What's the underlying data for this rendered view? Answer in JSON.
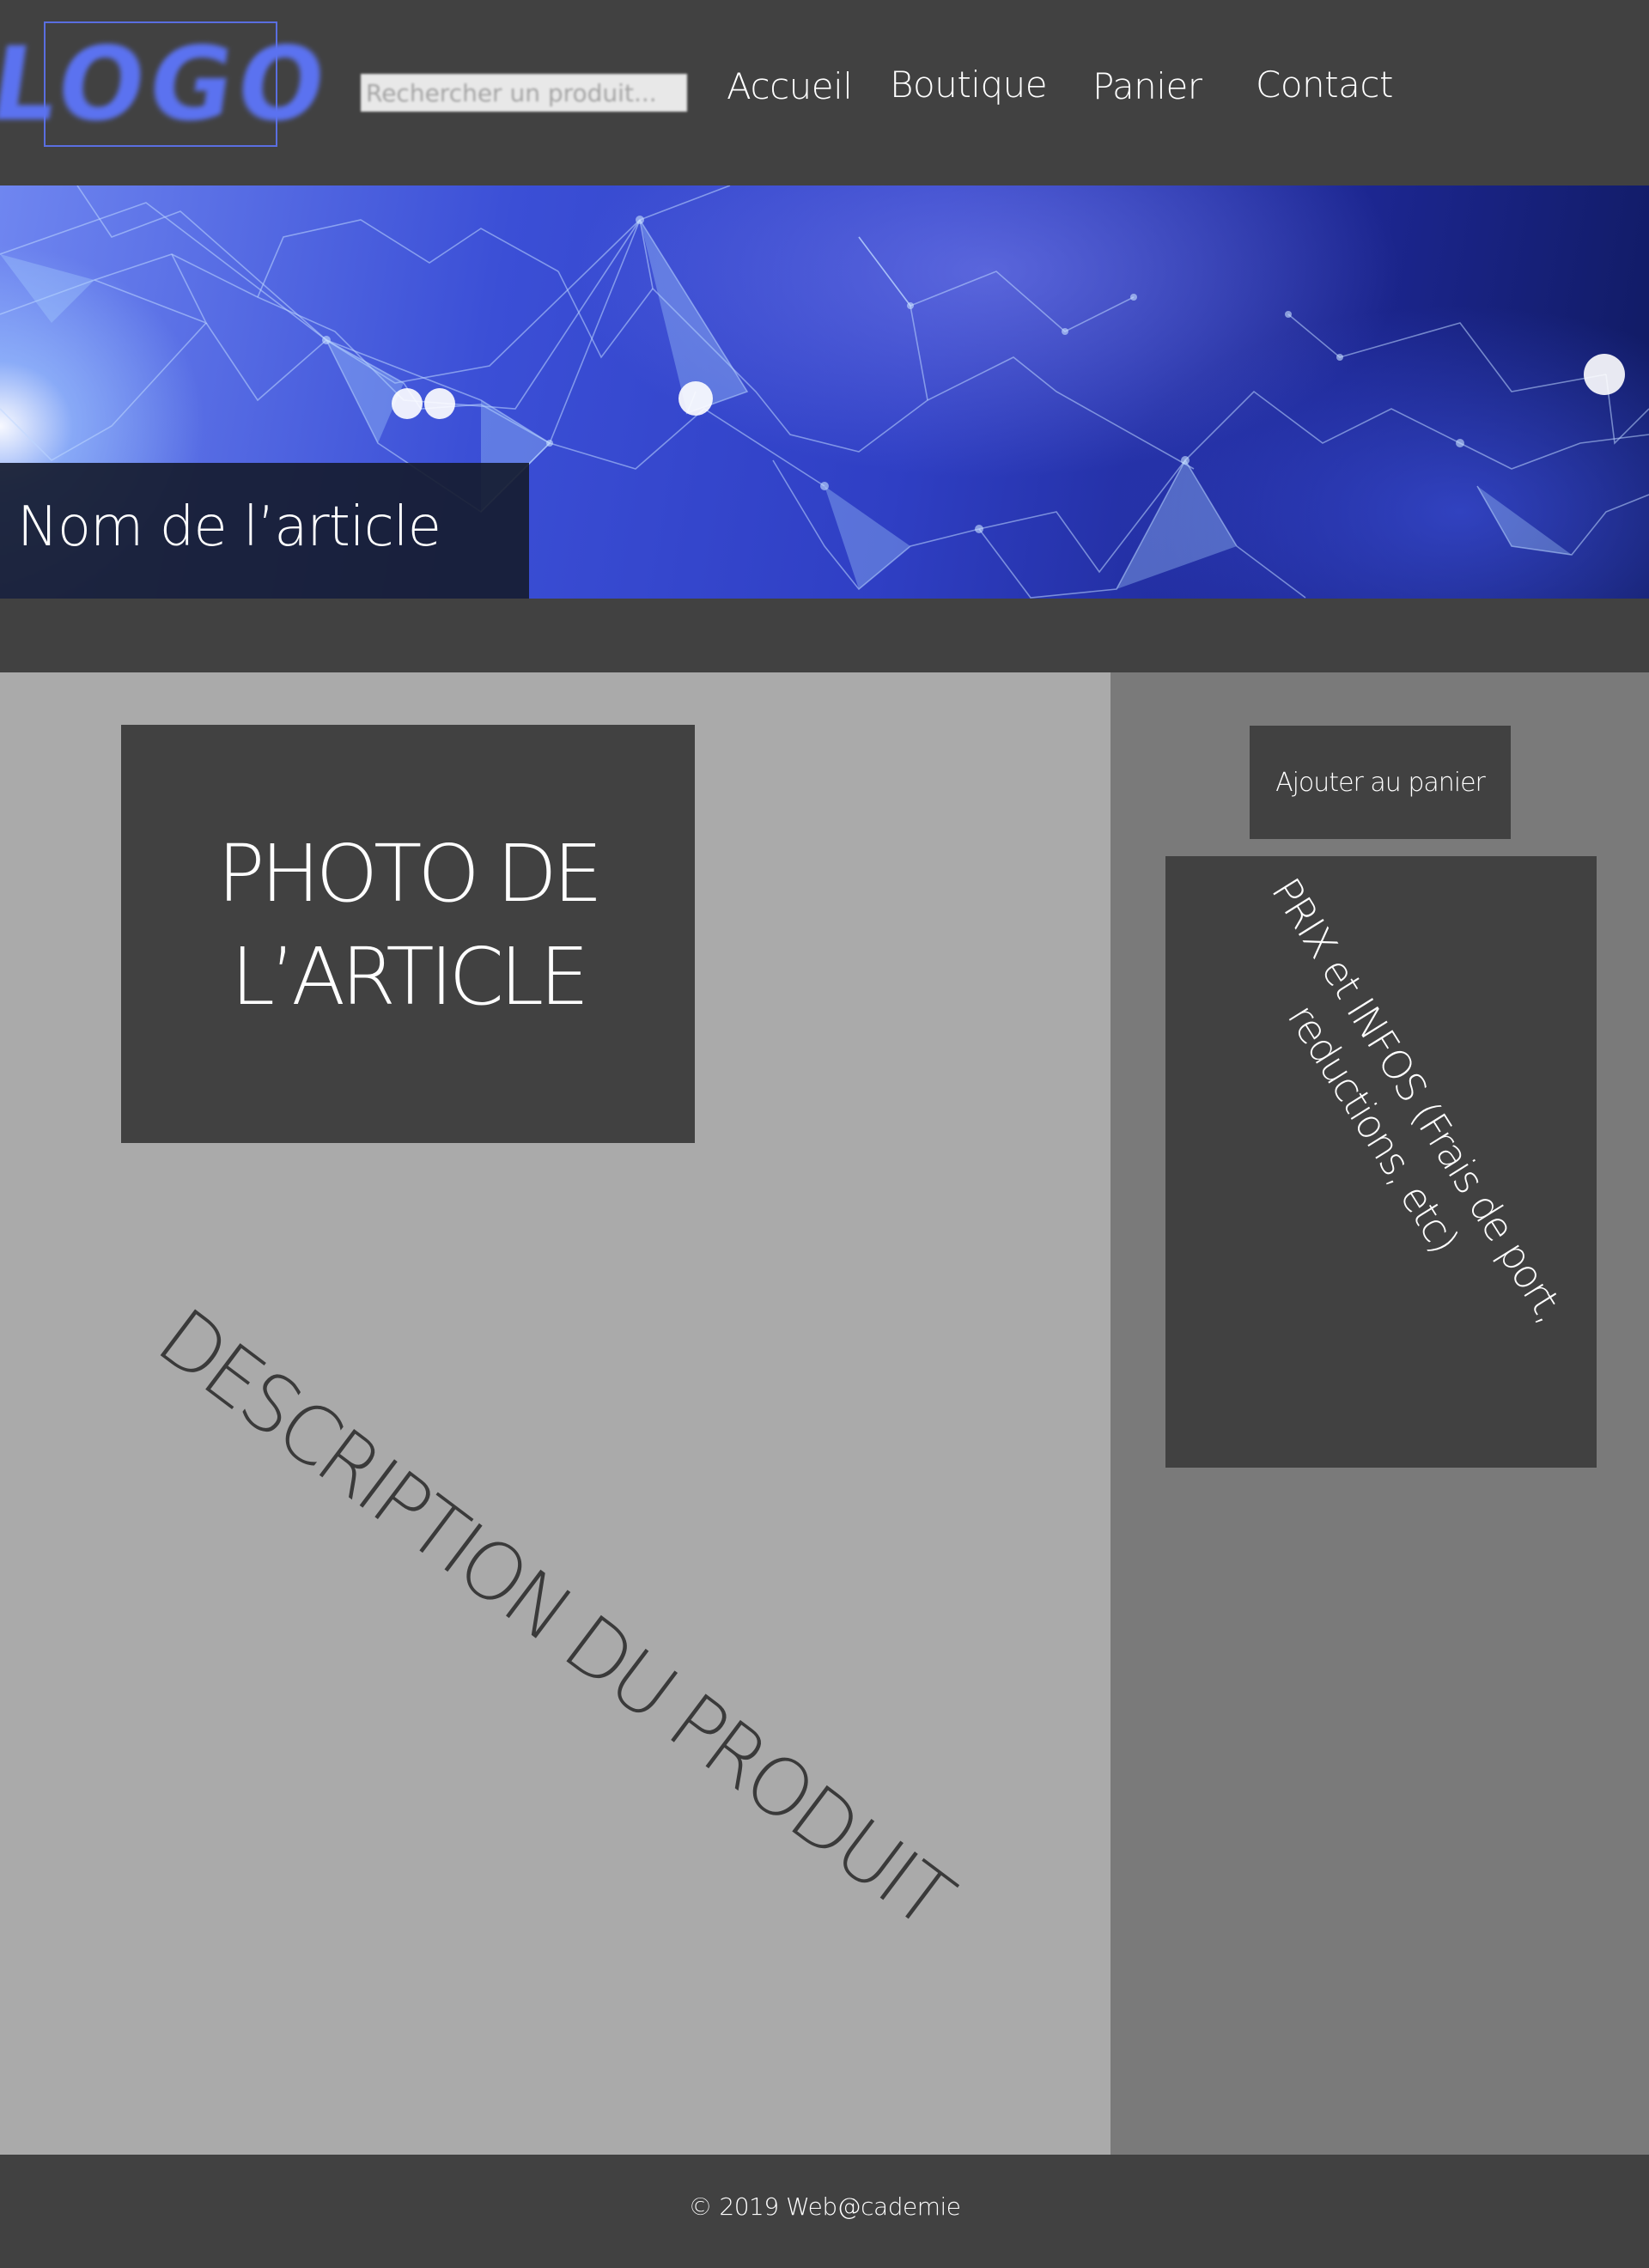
{
  "header": {
    "logo_text": "LOGO",
    "search": {
      "placeholder": "Rechercher un produit...",
      "value": ""
    },
    "nav": {
      "accueil": "Accueil",
      "boutique": "Boutique",
      "panier": "Panier",
      "contact": "Contact"
    }
  },
  "banner": {
    "article_name": "Nom de l’article"
  },
  "main": {
    "photo": {
      "line1": "PHOTO DE",
      "line2": "L’ARTICLE"
    },
    "description": "DESCRIPTION DU PRODUIT"
  },
  "sidebar": {
    "add_to_cart_label": "Ajouter au panier",
    "price_info": {
      "line1": "PRIX et INFOS (Frais de port,",
      "line2": "reductions, etc)"
    }
  },
  "footer": {
    "copyright": "© 2019 Web@cademie"
  },
  "colors": {
    "header_bg": "#414141",
    "logo_accent": "#5b72f0",
    "main_left_bg": "#aaaaaa",
    "main_right_bg": "#7a7a7a",
    "box_bg": "#414141",
    "banner_blue": "#2f3fc4"
  }
}
